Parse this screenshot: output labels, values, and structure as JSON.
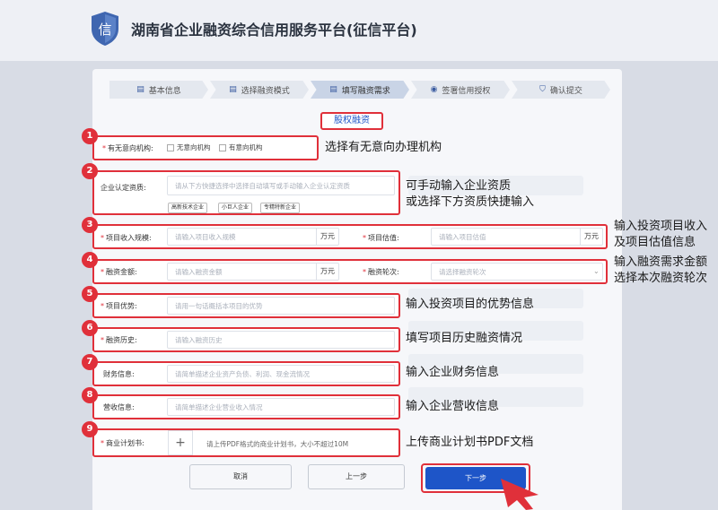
{
  "header": {
    "title": "湖南省企业融资综合信用服务平台(征信平台)",
    "logo_glyph": "信"
  },
  "steps": [
    {
      "label": "基本信息",
      "icon": "doc-icon"
    },
    {
      "label": "选择融资模式",
      "icon": "doc-icon"
    },
    {
      "label": "填写融资需求",
      "icon": "doc-icon",
      "active": true
    },
    {
      "label": "签署信用授权",
      "icon": "auth-icon"
    },
    {
      "label": "确认提交",
      "icon": "shield-icon"
    }
  ],
  "mode_tab": "股权融资",
  "rows": {
    "r1": {
      "num": "1",
      "label": "有无意向机构:",
      "options": [
        "无意向机构",
        "有意向机构"
      ],
      "annotation": "选择有无意向办理机构"
    },
    "r2": {
      "num": "2",
      "label": "企业认定资质:",
      "placeholder": "请从下方快捷选择中选择自动填写或手动输入企业认定资质",
      "tags": [
        "高新技术企业",
        "小巨人企业",
        "专精特新企业"
      ],
      "annotation1": "可手动输入企业资质",
      "annotation2": "或选择下方资质快捷输入"
    },
    "r3": {
      "num": "3",
      "label1": "项目收入规模:",
      "placeholder1": "请输入项目收入规模",
      "unit1": "万元",
      "label2": "项目估值:",
      "placeholder2": "请输入项目估值",
      "unit2": "万元",
      "annotation1": "输入投资项目收入",
      "annotation2": "及项目估值信息"
    },
    "r4": {
      "num": "4",
      "label1": "融资金额:",
      "placeholder1": "请输入融资金额",
      "unit1": "万元",
      "label2": "融资轮次:",
      "placeholder2": "请选择融资轮次",
      "annotation1": "输入融资需求金额",
      "annotation2": "选择本次融资轮次"
    },
    "r5": {
      "num": "5",
      "label": "项目优势:",
      "placeholder": "请用一句话概括本项目的优势",
      "annotation": "输入投资项目的优势信息"
    },
    "r6": {
      "num": "6",
      "label": "融资历史:",
      "placeholder": "请输入融资历史",
      "annotation": "填写项目历史融资情况"
    },
    "r7": {
      "num": "7",
      "label": "财务信息:",
      "placeholder": "请简单描述企业资产负债、利润、现金流情况",
      "annotation": "输入企业财务信息"
    },
    "r8": {
      "num": "8",
      "label": "营收信息:",
      "placeholder": "请简单描述企业营业收入情况",
      "annotation": "输入企业营收信息"
    },
    "r9": {
      "num": "9",
      "label": "商业计划书:",
      "hint": "请上传PDF格式的商业计划书，大小不超过10M",
      "annotation": "上传商业计划书PDF文档"
    }
  },
  "buttons": {
    "cancel": "取消",
    "prev": "上一步",
    "next": "下一步"
  },
  "colors": {
    "accent": "#e0303a",
    "primary": "#1e55c8"
  }
}
